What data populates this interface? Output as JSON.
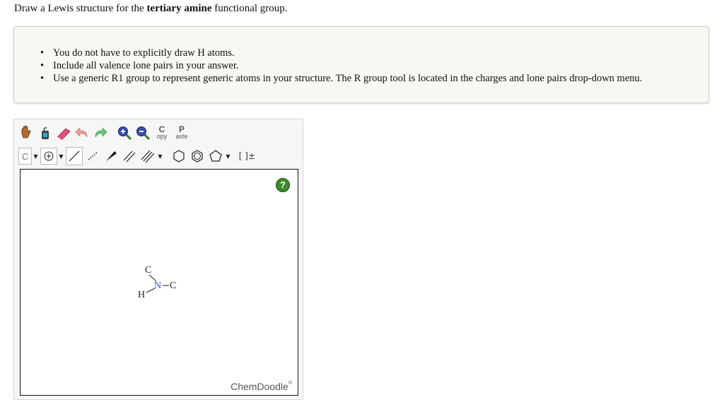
{
  "question": {
    "prefix": "Draw a Lewis structure for the ",
    "bold": "tertiary amine",
    "suffix": " functional group."
  },
  "notes": [
    "You do not have to explicitly draw H atoms.",
    "Include all valence lone pairs in your answer.",
    "Use a generic R1 group to represent generic atoms in your structure. The R group tool is located in the charges and lone pairs drop-down menu."
  ],
  "toolbar": {
    "copy_big": "C",
    "copy_small": "opy",
    "paste_big": "P",
    "paste_small": "aste",
    "atom_label": "C",
    "bracket_label": "[ ]±"
  },
  "canvas": {
    "help_label": "?",
    "brand": "ChemDoodle",
    "brand_mark": "®",
    "atoms": {
      "c_top": "C",
      "n": "N",
      "c_right": "C",
      "h": "H"
    }
  },
  "colors": {
    "help_green": "#3e8a2e",
    "nitrogen": "#3050f8"
  }
}
